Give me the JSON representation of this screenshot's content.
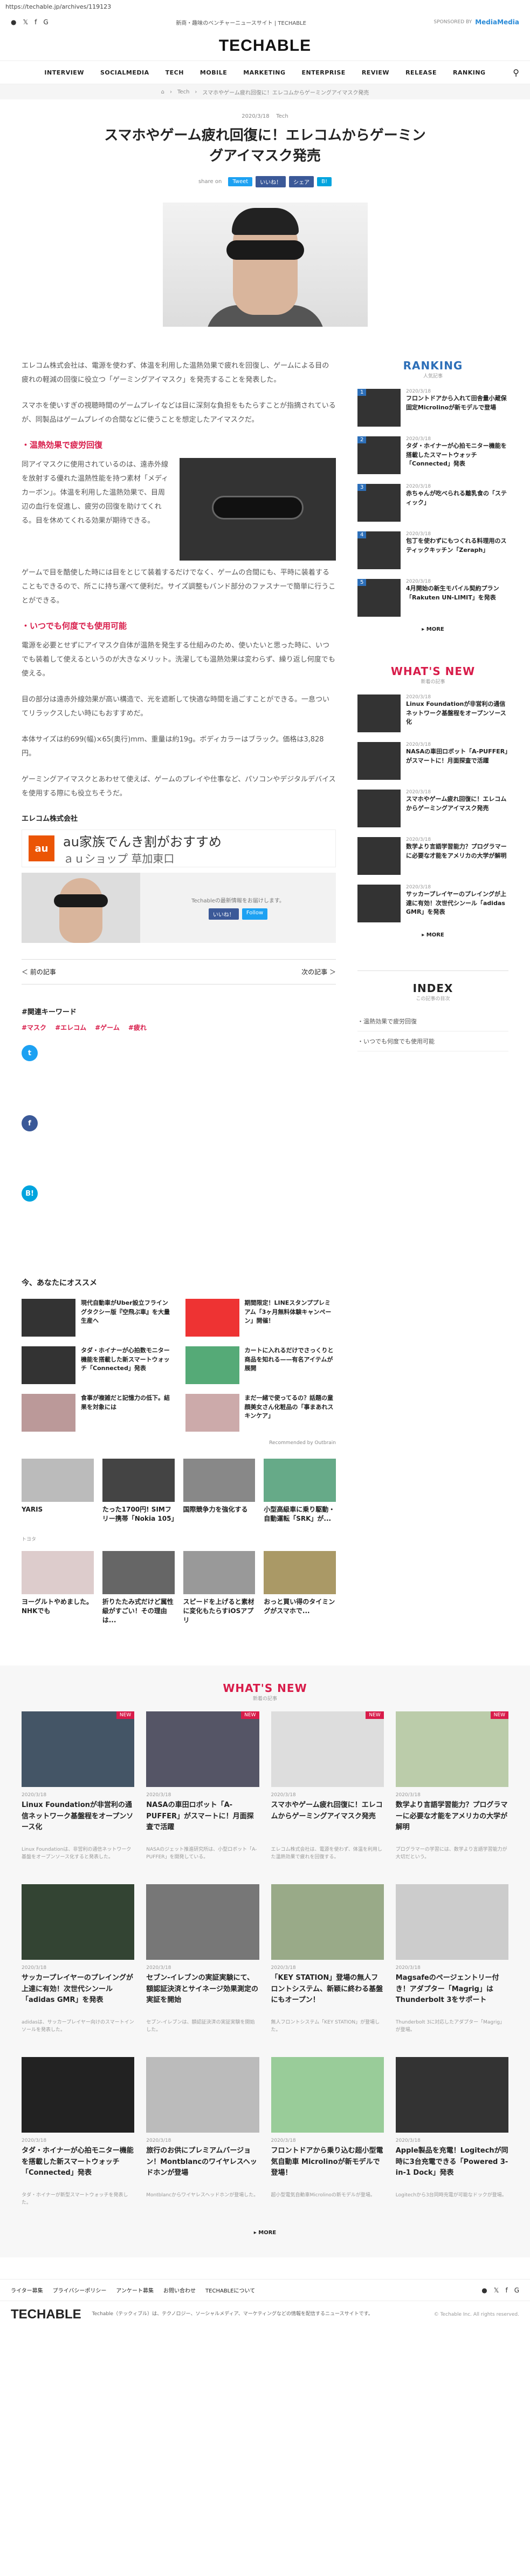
{
  "url": "https://techable.jp/archives/119123",
  "header": {
    "social": [
      "●",
      "𝕏",
      "f",
      "G"
    ],
    "tagline": "新商・趣味のベンチャーニュースサイト | TECHABLE",
    "sponsor_label": "SPONSORED BY",
    "sponsor_name": "MediaMedia",
    "logo": "TECHABLE"
  },
  "nav": [
    "INTERVIEW",
    "SOCIALMEDIA",
    "TECH",
    "MOBILE",
    "MARKETING",
    "ENTERPRISE",
    "REVIEW",
    "RELEASE",
    "RANKING"
  ],
  "breadcrumb": [
    "⌂",
    "Tech",
    "スマホやゲーム疲れ回復に！エレコムからゲーミングアイマスク発売"
  ],
  "article": {
    "date": "2020/3/18",
    "category": "Tech",
    "title": "スマホやゲーム疲れ回復に！エレコムからゲーミングアイマスク発売",
    "share_label": "share on",
    "share_buttons": [
      "Tweet",
      "いいね！",
      "シェア",
      "B!"
    ],
    "p1": "エレコム株式会社は、電源を使わず、体温を利用した温熱効果で疲れを回復し、ゲームによる目の疲れの軽減の回復に役立つ「ゲーミングアイマスク」を発売することを発表した。",
    "p2": "スマホを使いすぎの視聴時間のゲームプレイなどは目に深刻な負担をもたらすことが指摘されているが、同製品はゲームプレイの合間などに使うことを想定したアイマスクだ。",
    "h2_1": "・温熱効果で疲労回復",
    "p3": "同アイマスクに使用されているのは、遠赤外線を放射する優れた温熱性能を持つ素材「メディカーボン」。体温を利用した温熱効果で、目周辺の血行を促進し、疲労の回復を助けてくれる。目を休めてくれる効果が期待できる。",
    "p4": "ゲームで目を酷使した時には目をとじて装着するだけでなく、ゲームの合間にも、平時に装着することもできるので、所こに持ち運べて便利だ。サイズ調整もバンド部分のファスナーで簡単に行うことができる。",
    "h2_2": "・いつでも何度でも使用可能",
    "p5": "電源を必要とせずにアイマスク自体が温熱を発生する仕組みのため、使いたいと思った時に、いつでも装着して使えるというのが大きなメリット。洗濯しても温熱効果は変わらず、繰り返し何度でも使える。",
    "p6": "目の部分は遠赤外線効果が高い構造で、光を遮断して快適な時間を過ごすことができる。一息ついてリラックスしたい時にもおすすめだ。",
    "p7": "本体サイズは約699(幅)×65(奥行)mm、重量は約19g。ボディカラーはブラック。価格は3,828円。",
    "p8": "ゲーミングアイマスクとあわせて使えば、ゲームのプレイや仕事など、パソコンやデジタルデバイスを使用する際にも役立ちそうだ。",
    "company": "エレコム株式会社"
  },
  "ad": {
    "logo": "au",
    "line1": "au家族でんき割がおすすめ",
    "line2": "ａｕショップ 草加東口"
  },
  "likebox": {
    "text": "Techableの最新情報をお届けします。",
    "like": "いいね！",
    "follow": "Follow"
  },
  "pager": {
    "prev": "＜ 前の記事",
    "next": "次の記事 ＞"
  },
  "keywords": {
    "title": "#関連キーワード",
    "items": [
      "#マスク",
      "#エレコム",
      "#ゲーム",
      "#疲れ"
    ]
  },
  "recommend": {
    "title": "今、あなたにオススメ",
    "items": [
      {
        "title": "現代自動車がUber設立フライングタクシー版『空飛ぶ車』を大量生産へ",
        "source": ""
      },
      {
        "title": "期間限定！LINEスタンププレミアム「3ヶ月無料体験キャンペーン」開催！",
        "source": ""
      },
      {
        "title": "タダ・ホイナーが心拍数モニター機能を搭載した新スマートウォッチ「Connected」発表",
        "source": ""
      },
      {
        "title": "カートに入れるだけでさっくりと商品を知れる——有名アイテムが展開",
        "source": ""
      },
      {
        "title": "食事が複雑だと記憶力の低下。結果を対象には",
        "source": ""
      },
      {
        "title": "まだ一緒で使ってるの？話題の童顔美女さん化粧品の「事まあれスキンケア」",
        "source": ""
      }
    ],
    "outbrain": "Recommended by Outbrain"
  },
  "ads": [
    {
      "title": "YARIS",
      "source": "トヨタ"
    },
    {
      "title": "たった1700円! SIMフリー携帯「Nokia 105」",
      "source": ""
    },
    {
      "title": "国際競争力を強化する",
      "source": ""
    },
    {
      "title": "小型高級車に乗り駆動・自動運転「SRK」が...",
      "source": ""
    },
    {
      "title": "ヨーグルトやめました。NHKでも",
      "source": ""
    },
    {
      "title": "折りたたみ式だけど属性級がすごい！その理由は...",
      "source": ""
    },
    {
      "title": "スピードを上げると素材に変化もたらすiOSアプリ",
      "source": ""
    },
    {
      "title": "おっと買い得のタイミングがスマホで...",
      "source": ""
    }
  ],
  "ranking": {
    "title": "RANKING",
    "sub": "人気記事",
    "items": [
      {
        "num": "1",
        "date": "2020/3/18",
        "title": "フロントドアから入れて田舎量小蔵保固定Microlinoが新モデルで登場"
      },
      {
        "num": "2",
        "date": "2020/3/18",
        "title": "タダ・ホイナーが心拍モニター機能を搭載したスマートウォッチ「Connected」発表"
      },
      {
        "num": "3",
        "date": "2020/3/18",
        "title": "赤ちゃんが吃べられる離乳食の「スティック」"
      },
      {
        "num": "4",
        "date": "2020/3/18",
        "title": "包丁を使わずにもつくれる料理用のスティックキッチン「Zeraph」"
      },
      {
        "num": "5",
        "date": "2020/3/18",
        "title": "4月開始の新生モバイル契約プラン「Rakuten UN-LIMIT」を発表"
      }
    ],
    "more": "▸ MORE"
  },
  "whatsnew_side": {
    "title": "WHAT'S NEW",
    "sub": "新着の記事",
    "items": [
      {
        "date": "2020/3/18",
        "title": "Linux Foundationが非営利の通信ネットワーク基盤程をオープンソース化"
      },
      {
        "date": "2020/3/18",
        "title": "NASAの車田ロボット「A-PUFFER」がスマートに！月面探査で活躍"
      },
      {
        "date": "2020/3/18",
        "title": "スマホやゲーム疲れ回復に！エレコムからゲーミングアイマスク発売"
      },
      {
        "date": "2020/3/18",
        "title": "数学より言語学習能力？プログラマーに必要な才能をアメリカの大学が解明"
      },
      {
        "date": "2020/3/18",
        "title": "サッカープレイヤーのプレイングが上達に有効！次世代シンール「adidas GMR」を発表"
      }
    ],
    "more": "▸ MORE"
  },
  "index": {
    "title": "INDEX",
    "sub": "この記事の目次",
    "items": [
      "・温熱効果で疲労回復",
      "・いつでも何度でも使用可能"
    ]
  },
  "whatsnew_bottom": {
    "title": "WHAT'S NEW",
    "sub": "新着の記事",
    "items": [
      {
        "date": "2020/3/18",
        "title": "Linux Foundationが非営利の通信ネットワーク基盤程をオープンソース化",
        "excerpt": "Linux Foundationは、非営利の通信ネットワーク基盤をオープンソース化すると発表した。"
      },
      {
        "date": "2020/3/18",
        "title": "NASAの車田ロボット「A-PUFFER」がスマートに！月面探査で活躍",
        "excerpt": "NASAのジェット推進研究所は、小型ロボット「A-PUFFER」を開発している。"
      },
      {
        "date": "2020/3/18",
        "title": "スマホやゲーム疲れ回復に！エレコムからゲーミングアイマスク発売",
        "excerpt": "エレコム株式会社は、電源を使わず、体温を利用した温熱効果で疲れを回復する。"
      },
      {
        "date": "2020/3/18",
        "title": "数学より言語学習能力？プログラマーに必要な才能をアメリカの大学が解明",
        "excerpt": "プログラマーの学習には、数学より言語学習能力が大切だという。"
      },
      {
        "date": "2020/3/18",
        "title": "サッカープレイヤーのプレイングが上達に有効！次世代シンール「adidas GMR」を発表",
        "excerpt": "adidasは、サッカープレイヤー向けのスマートインソールを発表した。"
      },
      {
        "date": "2020/3/18",
        "title": "セブン-イレブンの実証実験にて、額認証決済とサイネージ効果測定の実証を開始",
        "excerpt": "セブン-イレブンは、額認証決済の実証実験を開始した。"
      },
      {
        "date": "2020/3/18",
        "title": "「KEY STATION」登場の無人フロントシステム、新颖に終わる基盤にもオープン！",
        "excerpt": "無人フロントシステム「KEY STATION」が登場した。"
      },
      {
        "date": "2020/3/18",
        "title": "Magsafeのページェントリー付き！アダプター「Magrig」はThunderbolt 3をサポート",
        "excerpt": "Thunderbolt 3に対応したアダプター「Magrig」が登場。"
      },
      {
        "date": "2020/3/18",
        "title": "タダ・ホイナーが心拍モニター機能を搭載した新スマートウォッチ「Connected」発表",
        "excerpt": "タダ・ホイナーが新型スマートウォッチを発表した。"
      },
      {
        "date": "2020/3/18",
        "title": "旅行のお供にプレミアムバージョン！Montblancのワイヤレスヘッドホンが登場",
        "excerpt": "Montblancからワイヤレスヘッドホンが登場した。"
      },
      {
        "date": "2020/3/18",
        "title": "フロントドアから乗り込む超小型電気自動車 Microlinoが新モデルで登場！",
        "excerpt": "超小型電気自動車Microlinoの新モデルが登場。"
      },
      {
        "date": "2020/3/18",
        "title": "Apple製品を充電！Logitechが同時に3台充電できる「Powered 3-in-1 Dock」発表",
        "excerpt": "Logitechから3台同時充電が可能なドックが登場。"
      }
    ],
    "more": "▸ MORE"
  },
  "footer": {
    "links": [
      "ライター募集",
      "プライバシーポリシー",
      "アンケート募集",
      "お問い合わせ",
      "TECHABLEについて"
    ],
    "logo": "TECHABLE",
    "desc": "Techable（テックィブル）は、テクノロジー、ソーシャルメディア、マーケティングなどの情報を配信するニュースサイトです。",
    "copyright": "© Techable Inc. All rights reserved."
  },
  "colors": {
    "accent": "#d81c4a",
    "blue": "#2d6fb8"
  }
}
